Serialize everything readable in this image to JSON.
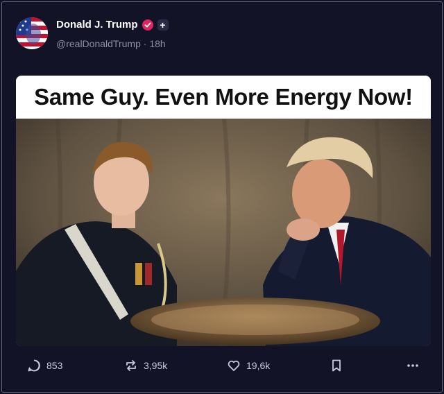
{
  "post": {
    "author_name": "Donald J. Trump",
    "handle": "@realDonaldTrump",
    "separator": "·",
    "time_ago": "18h",
    "image_caption": "Same Guy. Even More Energy Now!"
  },
  "actions": {
    "replies": "853",
    "reposts": "3,95k",
    "likes": "19,6k"
  },
  "colors": {
    "background": "#121327",
    "verified": "#e0245e",
    "muted_text": "#8d8fa8"
  },
  "icons": [
    "reply-icon",
    "repost-icon",
    "like-icon",
    "bookmark-icon",
    "more-icon",
    "verified-icon"
  ]
}
